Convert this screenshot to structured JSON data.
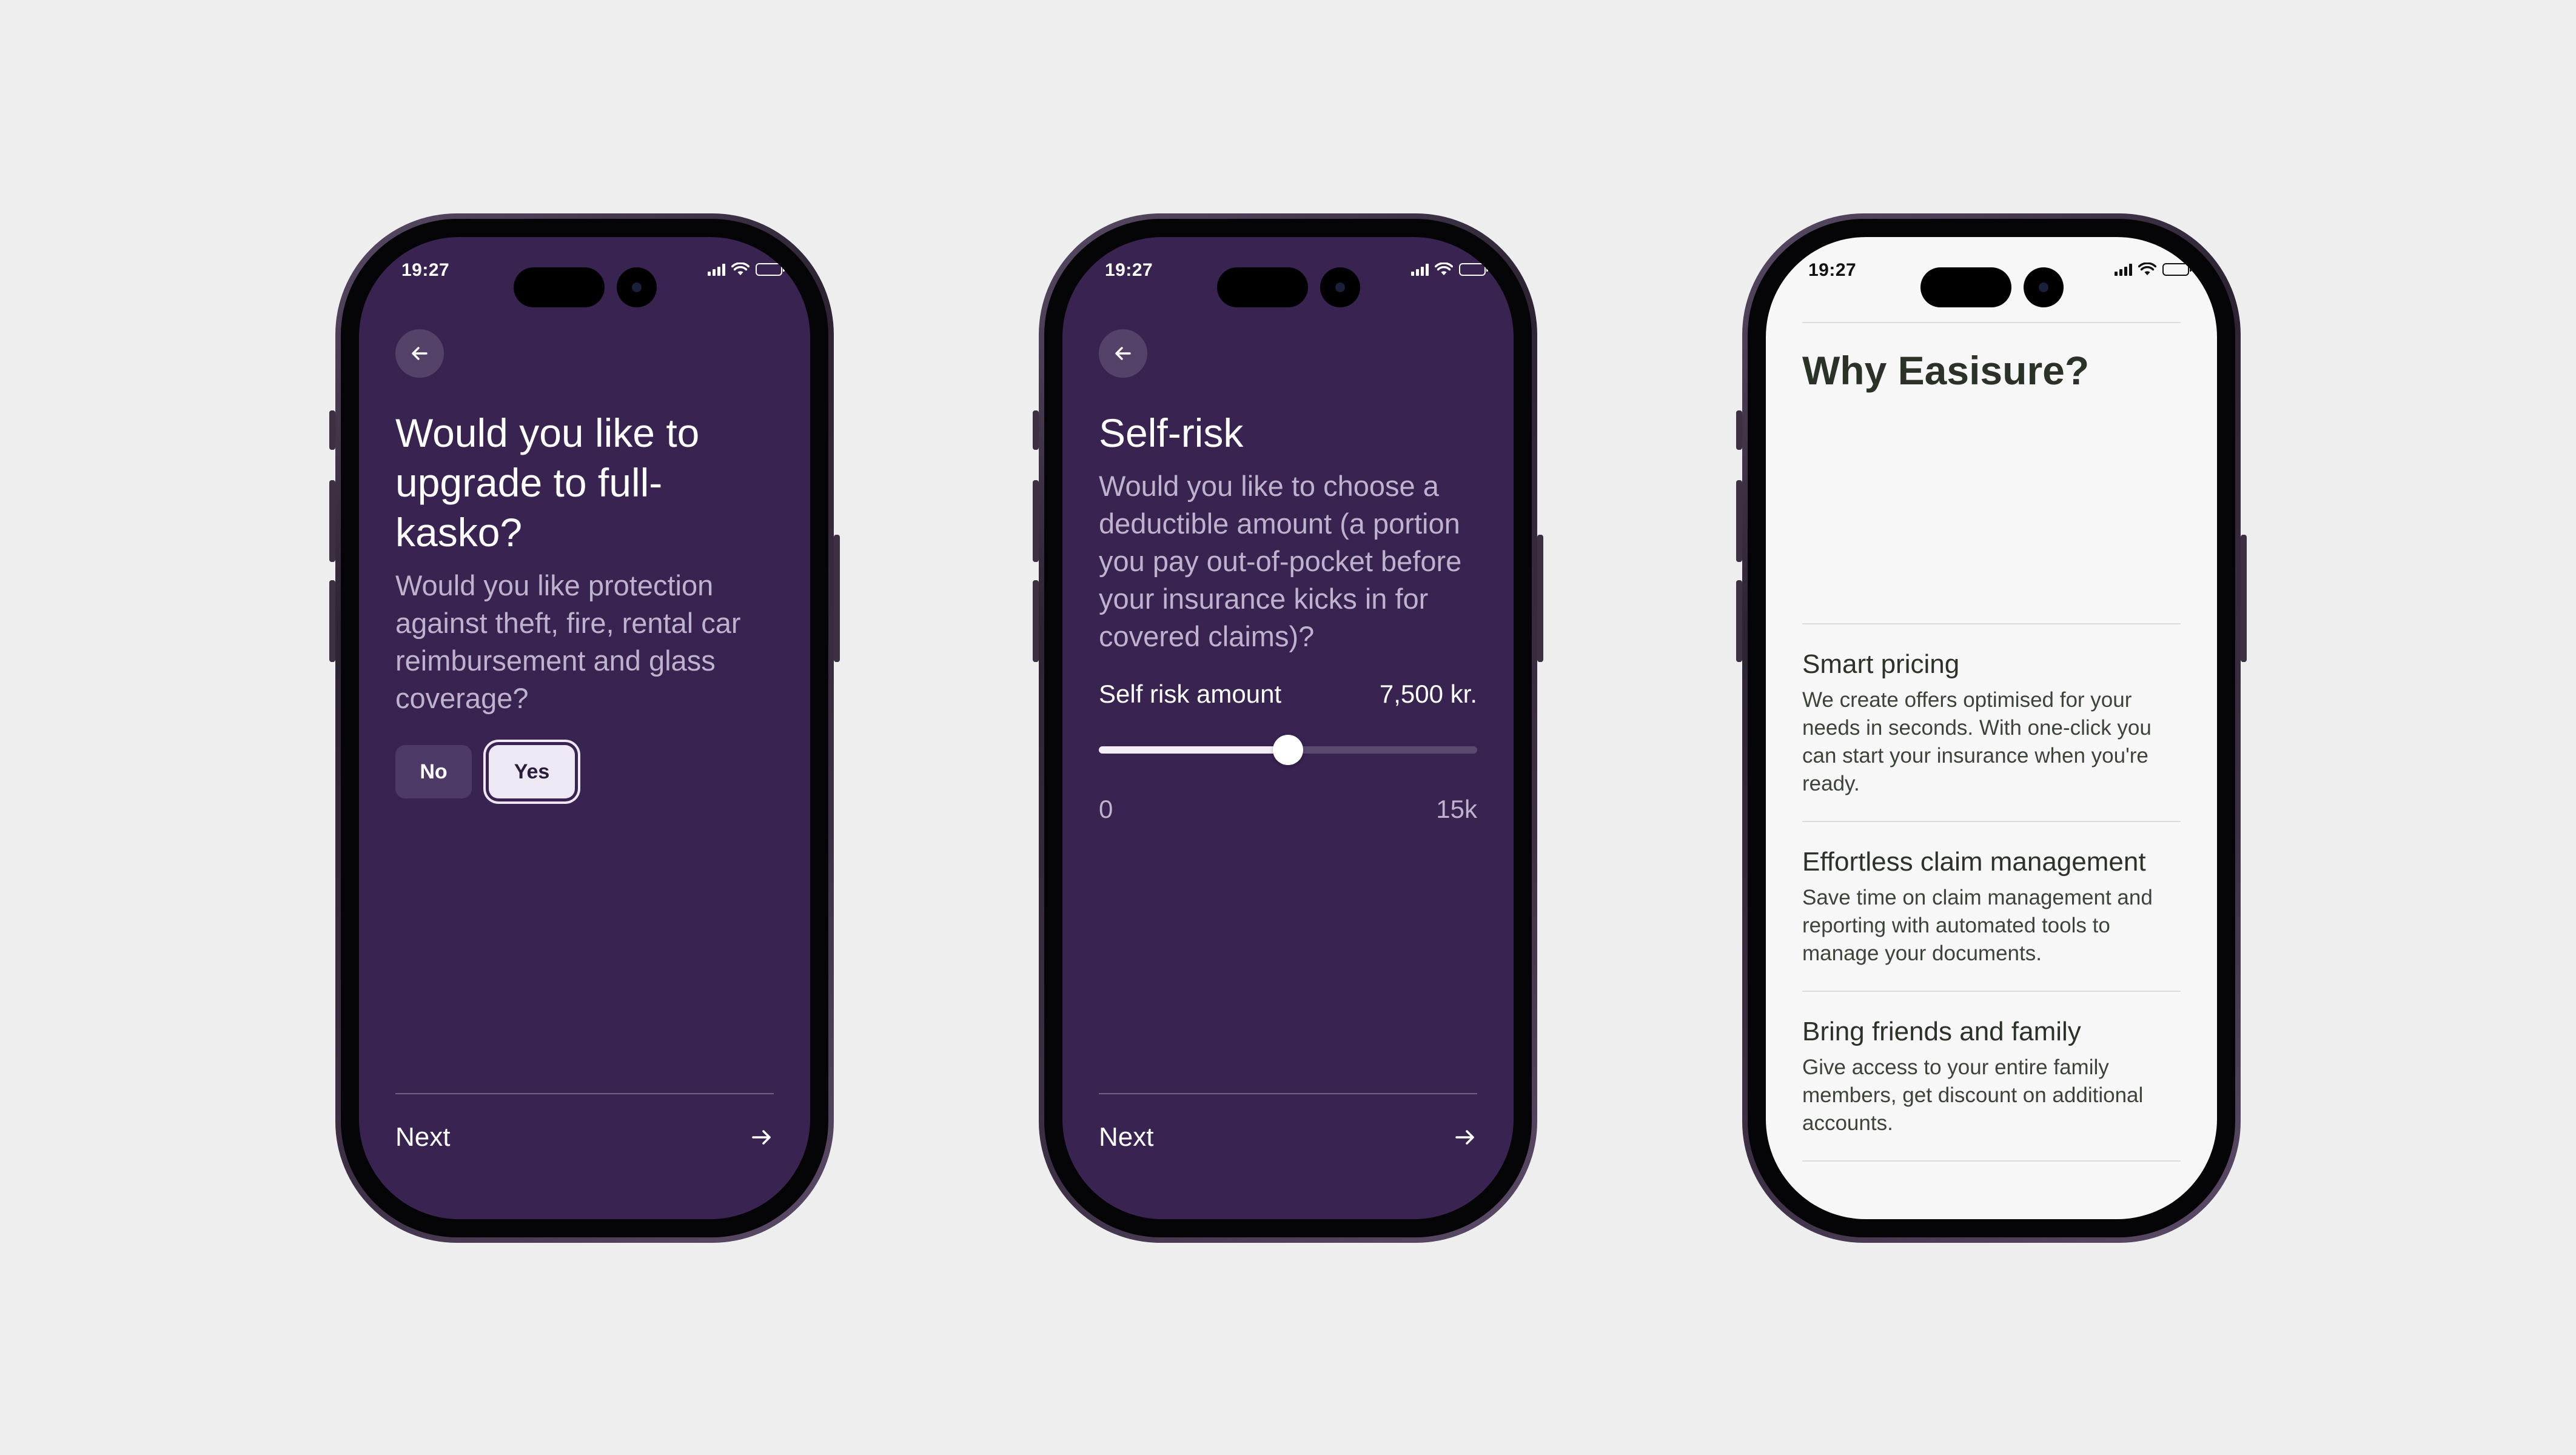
{
  "status_bar": {
    "time": "19:27"
  },
  "screens": {
    "upgrade": {
      "title": "Would you like to upgrade to full-kasko?",
      "description": "Would you like protection against theft, fire, rental car reimbursement and glass coverage?",
      "options": {
        "no": "No",
        "yes": "Yes",
        "selected": "Yes"
      },
      "next_label": "Next"
    },
    "self_risk": {
      "title": "Self-risk",
      "description": "Would you like to choose a deductible amount (a portion you pay out-of-pocket before your insurance kicks in for covered claims)?",
      "slider": {
        "label": "Self risk amount",
        "value_label": "7,500 kr.",
        "value": 7500,
        "min": 0,
        "max": 15000,
        "min_label": "0",
        "max_label": "15k"
      },
      "next_label": "Next"
    },
    "why": {
      "title": "Why Easisure?",
      "features": [
        {
          "title": "Smart pricing",
          "text": "We create offers optimised for your needs in seconds. With one-click you can start your insurance when you're ready."
        },
        {
          "title": "Effortless claim management",
          "text": "Save time on claim management and reporting with automated tools to manage your documents."
        },
        {
          "title": "Bring friends and family",
          "text": "Give access to your entire family members, get discount on additional accounts."
        }
      ]
    }
  },
  "icons": {
    "back": "arrow-left-icon",
    "next": "arrow-right-icon",
    "signal": "signal-icon",
    "wifi": "wifi-icon",
    "battery": "battery-icon"
  },
  "colors": {
    "dark_bg": "#382351",
    "muted_text": "#BEB2CC",
    "light_bg": "#F7F7F7",
    "light_text": "#2B3328",
    "page_bg": "#EEEEEE"
  }
}
